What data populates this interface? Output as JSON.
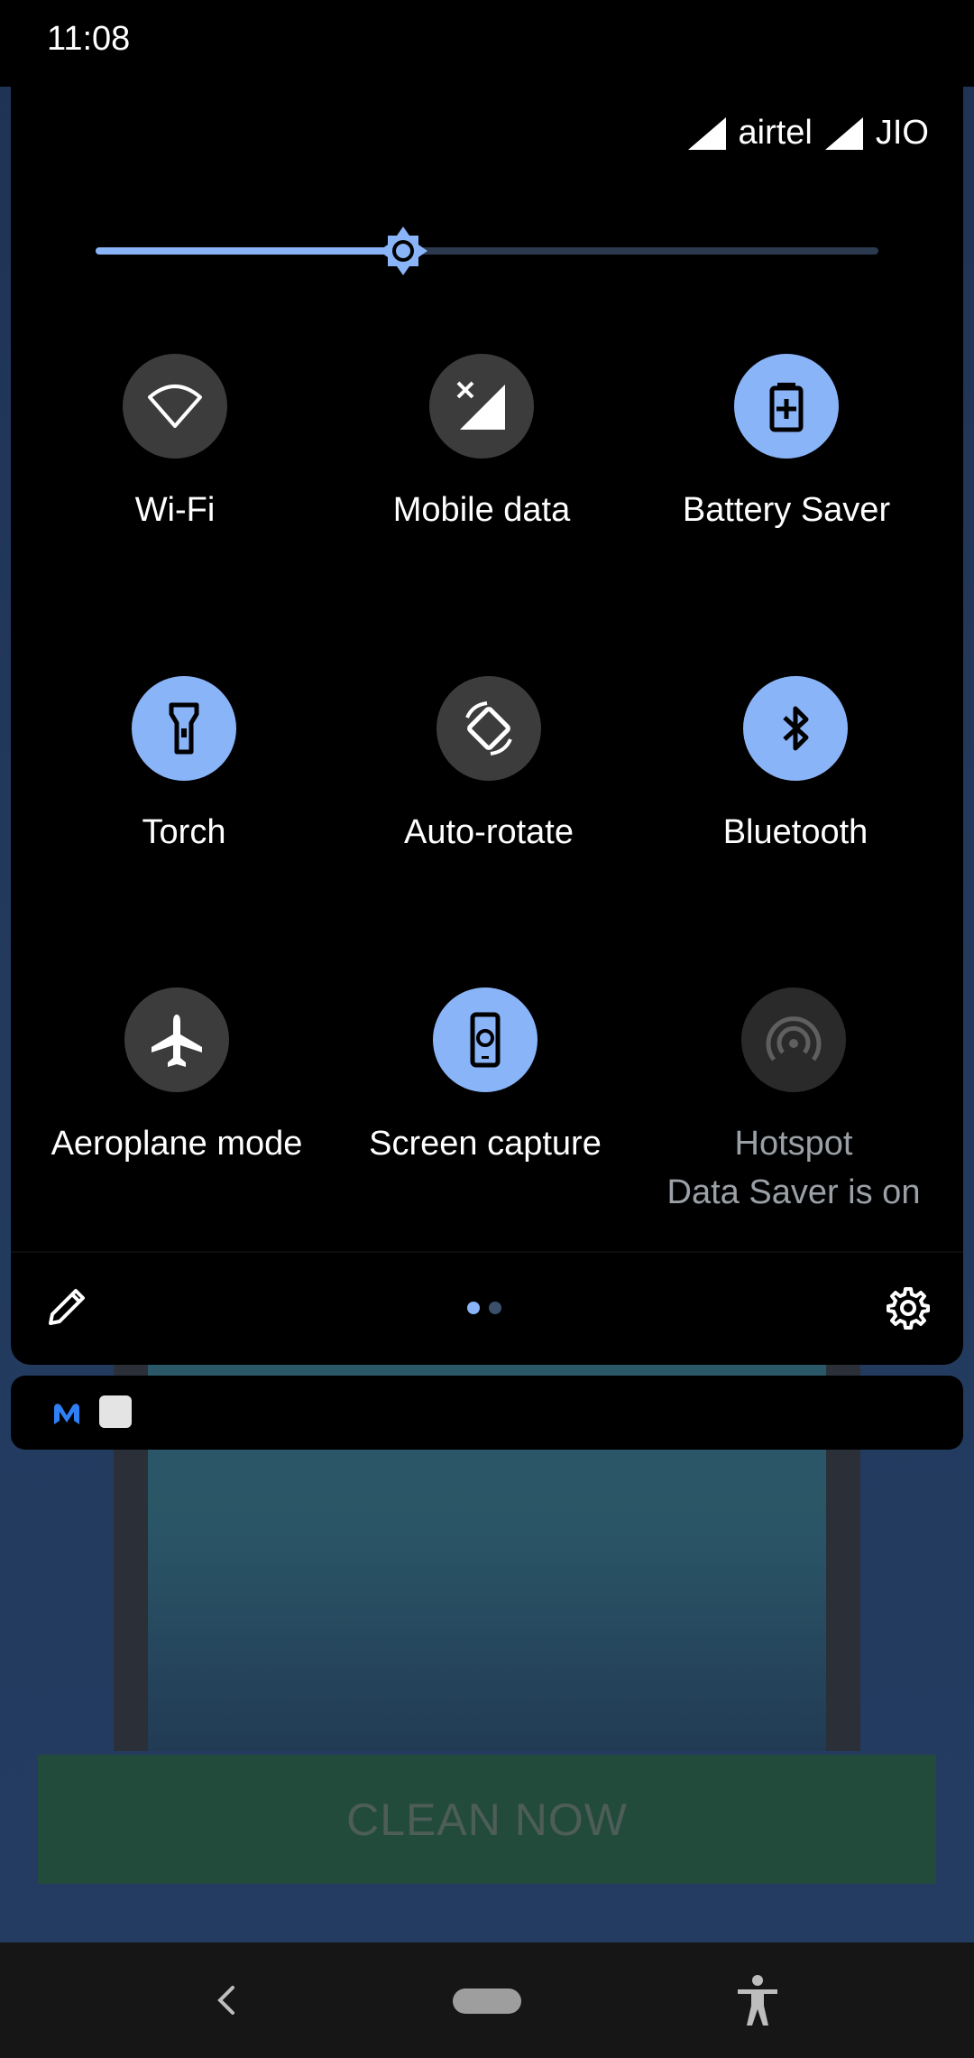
{
  "status_bar": {
    "time": "11:08"
  },
  "carriers": [
    {
      "name": "airtel"
    },
    {
      "name": "JIO"
    }
  ],
  "brightness": {
    "level": 0.4
  },
  "tiles": [
    {
      "label": "Wi-Fi",
      "state": "off",
      "icon": "wifi-icon"
    },
    {
      "label": "Mobile data",
      "state": "off",
      "icon": "mobile-data-off-icon"
    },
    {
      "label": "Battery Saver",
      "state": "on",
      "icon": "battery-saver-icon"
    },
    {
      "label": "Torch",
      "state": "on",
      "icon": "torch-icon"
    },
    {
      "label": "Auto-rotate",
      "state": "off",
      "icon": "auto-rotate-icon"
    },
    {
      "label": "Bluetooth",
      "state": "on",
      "icon": "bluetooth-icon"
    },
    {
      "label": "Aeroplane mode",
      "state": "off",
      "icon": "airplane-icon"
    },
    {
      "label": "Screen capture",
      "state": "on",
      "icon": "screen-capture-icon"
    },
    {
      "label": "Hotspot",
      "sublabel": "Data Saver is on",
      "state": "disabled",
      "icon": "hotspot-icon"
    }
  ],
  "pager": {
    "pages": 2,
    "current": 1
  },
  "background_app": {
    "button_label": "CLEAN NOW"
  },
  "colors": {
    "accent": "#8ab4f8",
    "tile_off": "#3c3c3c",
    "panel": "#000000"
  }
}
